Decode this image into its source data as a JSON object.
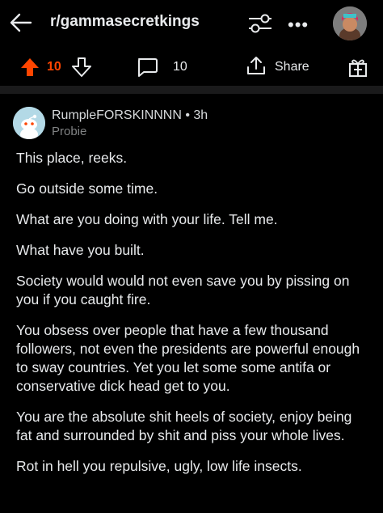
{
  "header": {
    "subreddit": "r/gammasecretkings",
    "back_icon": "arrow-left-icon",
    "filter_icon": "sliders-icon",
    "more_label": "•••"
  },
  "actions": {
    "vote_count": "10",
    "comment_count": "10",
    "share_label": "Share"
  },
  "comment": {
    "username_line": "RumpleFORSKINNNN • 3h",
    "flair": "Probie",
    "paragraphs": [
      "This place, reeks.",
      "Go outside some time.",
      "What are you doing with your life. Tell me.",
      "What have you built.",
      "Society would would not even save you by pissing on you if you caught fire.",
      "You obsess over people that have a few thousand followers, not even the presidents are powerful enough to sway countries. Yet you let some some antifa or conservative dick head get to you.",
      "You are the absolute shit heels of society, enjoy being fat and surrounded by shit and piss your whole lives.",
      "Rot in hell you repulsive, ugly, low life insects."
    ]
  },
  "colors": {
    "upvote": "#ff4500",
    "background": "#000000",
    "divider": "#1a1a1b"
  }
}
